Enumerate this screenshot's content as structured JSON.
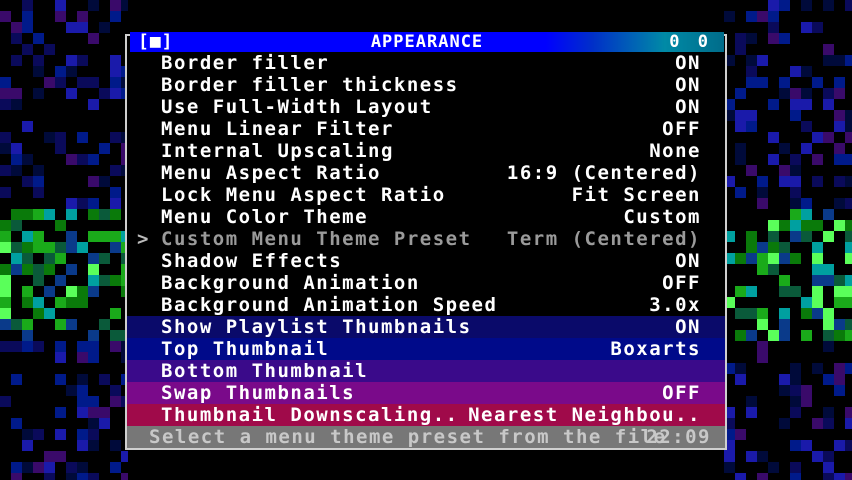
{
  "window": {
    "title": "APPEARANCE",
    "left_icon": "[■]",
    "right_indicator": "0 0"
  },
  "items": [
    {
      "label": "Border filler",
      "value": "ON"
    },
    {
      "label": "Border filler thickness",
      "value": "ON"
    },
    {
      "label": "Use Full-Width Layout",
      "value": "ON"
    },
    {
      "label": "Menu Linear Filter",
      "value": "OFF"
    },
    {
      "label": "Internal Upscaling",
      "value": "None"
    },
    {
      "label": "Menu Aspect Ratio",
      "value": "16:9 (Centered)"
    },
    {
      "label": "Lock Menu Aspect Ratio",
      "value": "Fit Screen"
    },
    {
      "label": "Menu Color Theme",
      "value": "Custom"
    },
    {
      "label": "Custom Menu Theme Preset",
      "value": "Term (Centered)"
    },
    {
      "label": "Shadow Effects",
      "value": "ON"
    },
    {
      "label": "Background Animation",
      "value": "OFF"
    },
    {
      "label": "Background Animation Speed",
      "value": "3.0x"
    },
    {
      "label": "Show Playlist Thumbnails",
      "value": "ON"
    },
    {
      "label": "Top Thumbnail",
      "value": "Boxarts"
    },
    {
      "label": "Bottom Thumbnail",
      "value": ""
    },
    {
      "label": "Swap Thumbnails",
      "value": "OFF"
    },
    {
      "label": "Thumbnail Downscaling..",
      "value": "Nearest Neighbou.."
    }
  ],
  "selected_arrow": ">",
  "status": {
    "text": "Select a menu theme preset from the file",
    "time": "22:09"
  },
  "colors": {
    "title_bg": "#0000ff",
    "selected_text": "#9a9a9a",
    "status_bg": "#777777"
  }
}
